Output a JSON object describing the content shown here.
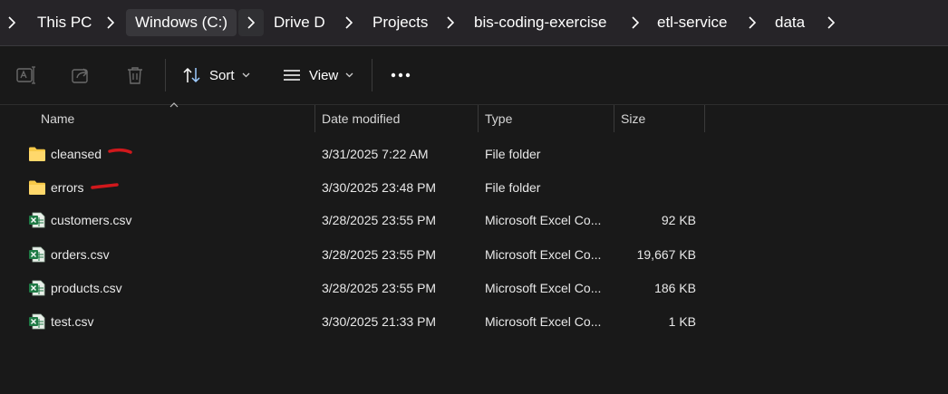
{
  "breadcrumb": {
    "items": [
      "This PC",
      "Windows (C:)",
      "Drive D",
      "Projects",
      "bis-coding-exercise",
      "etl-service",
      "data"
    ]
  },
  "toolbar": {
    "sort_label": "Sort",
    "view_label": "View"
  },
  "columns": {
    "name": "Name",
    "date": "Date modified",
    "type": "Type",
    "size": "Size"
  },
  "files": [
    {
      "name": "cleansed",
      "date": "3/31/2025 7:22 AM",
      "type": "File folder",
      "size": "",
      "icon": "folder-icon"
    },
    {
      "name": "errors",
      "date": "3/30/2025 23:48 PM",
      "type": "File folder",
      "size": "",
      "icon": "folder-icon"
    },
    {
      "name": "customers.csv",
      "date": "3/28/2025 23:55 PM",
      "type": "Microsoft Excel Co...",
      "size": "92 KB",
      "icon": "excel-file-icon"
    },
    {
      "name": "orders.csv",
      "date": "3/28/2025 23:55 PM",
      "type": "Microsoft Excel Co...",
      "size": "19,667 KB",
      "icon": "excel-file-icon"
    },
    {
      "name": "products.csv",
      "date": "3/28/2025 23:55 PM",
      "type": "Microsoft Excel Co...",
      "size": "186 KB",
      "icon": "excel-file-icon"
    },
    {
      "name": "test.csv",
      "date": "3/30/2025 21:33 PM",
      "type": "Microsoft Excel Co...",
      "size": "1 KB",
      "icon": "excel-file-icon"
    }
  ],
  "colors": {
    "background": "#191919",
    "breadcrumb_bar": "#262428",
    "folder": "#f7c948",
    "excel_green": "#1f7a45",
    "annotation_red": "#d0181c"
  }
}
